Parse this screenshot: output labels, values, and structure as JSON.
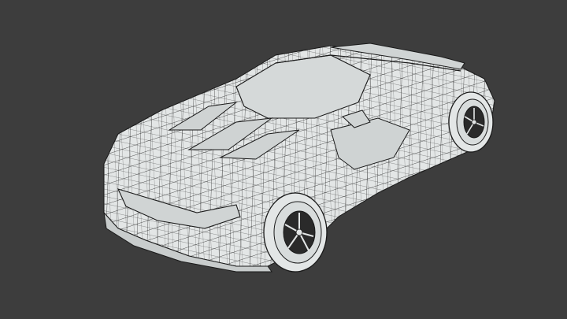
{
  "viewport": {
    "background_color": "#3d3d3d"
  },
  "model": {
    "subject": "car-wireframe-icon",
    "display_mode": "wireframe",
    "surface_color": "#e3e6e6",
    "shade_color": "#cfd3d3",
    "wire_color": "#1a1a1a",
    "tire_color": "#2a2a2a"
  }
}
